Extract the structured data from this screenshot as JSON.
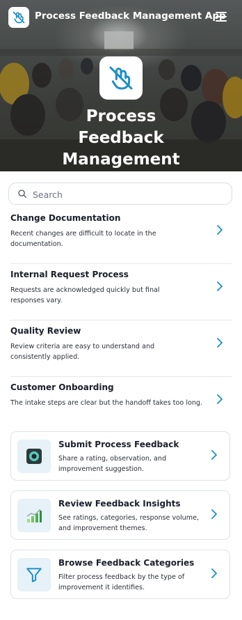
{
  "header": {
    "app_title": "Process Feedback Management App",
    "logo_icon": "hand-slash-icon",
    "menu_icon": "hamburger-menu-icon"
  },
  "hero": {
    "title": "Process Feedback Management App",
    "icon": "hand-slash-icon"
  },
  "search": {
    "placeholder": "Search",
    "icon": "search-icon"
  },
  "processes": [
    {
      "title": "Change Documentation",
      "description": "Recent changes are difficult to locate in the documentation."
    },
    {
      "title": "Internal Request Process",
      "description": "Requests are acknowledged quickly but final responses vary."
    },
    {
      "title": "Quality Review",
      "description": "Review criteria are easy to understand and consistently applied."
    },
    {
      "title": "Customer Onboarding",
      "description": "The intake steps are clear but the handoff takes too long."
    }
  ],
  "actions": [
    {
      "title": "Submit Process Feedback",
      "description": "Share a rating, observation, and improvement suggestion.",
      "icon": "camera-icon"
    },
    {
      "title": "Review Feedback Insights",
      "description": "See ratings, categories, response volume, and improvement themes.",
      "icon": "bar-chart-icon"
    },
    {
      "title": "Browse Feedback Categories",
      "description": "Filter process feedback by the type of improvement it identifies.",
      "icon": "filter-icon"
    }
  ],
  "colors": {
    "accent": "#1b8ec7",
    "thumb_background": "#e6f1f8"
  }
}
